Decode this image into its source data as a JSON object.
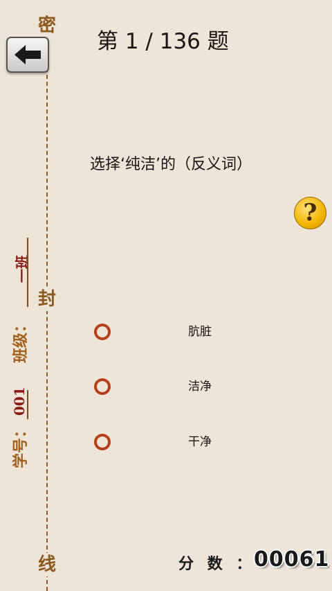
{
  "header": {
    "back_icon": "arrow-left-icon",
    "question_counter": "第 1 / 136  题"
  },
  "question": {
    "text": "选择‘纯洁’的（反义词）",
    "help_icon": "question-mark-icon",
    "help_label": "?"
  },
  "options": [
    {
      "label": "肮脏"
    },
    {
      "label": "洁净"
    },
    {
      "label": "干净"
    }
  ],
  "seal_margin": {
    "chars": [
      "密",
      "封",
      "线"
    ],
    "class_label": "班级：",
    "class_value": "一班",
    "student_label": "学号：",
    "student_value": "001"
  },
  "score": {
    "label": "分 数 ：",
    "value": "00061"
  },
  "colors": {
    "background": "#efe4d8",
    "radio_ring": "#b5401a",
    "help_button": "#f3b400",
    "seal_text": "#8a5a1e"
  }
}
